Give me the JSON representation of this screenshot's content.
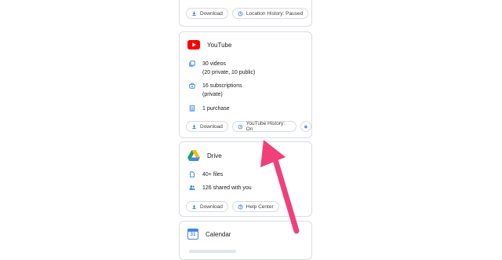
{
  "top_card": {
    "download": "Download",
    "location_history": "Location History: Paused"
  },
  "youtube": {
    "title": "YouTube",
    "videos_line1": "30 videos",
    "videos_line2": "(20 private, 10 public)",
    "subs_line1": "16 subscriptions",
    "subs_line2": "(private)",
    "purchase": "1 purchase",
    "download": "Download",
    "history": "YouTube History: On"
  },
  "drive": {
    "title": "Drive",
    "files": "40+ files",
    "shared": "126 shared with you",
    "download": "Download",
    "help": "Help Center"
  },
  "calendar": {
    "title": "Calendar",
    "badge": "31"
  },
  "colors": {
    "accent_blue": "#1a73e8",
    "youtube_red": "#ff0000",
    "arrow_pink": "#f0407a",
    "border": "#dadce0"
  }
}
